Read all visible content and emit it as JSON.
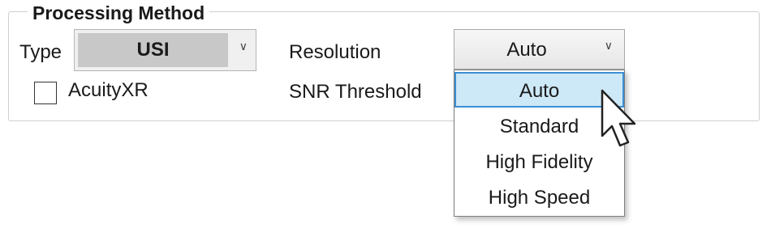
{
  "group": {
    "title": "Processing Method"
  },
  "type": {
    "label": "Type",
    "value": "USI",
    "arrow_icon": "chevron-down-icon"
  },
  "acuity": {
    "label": "AcuityXR",
    "checked": false
  },
  "resolution": {
    "label": "Resolution",
    "value": "Auto",
    "arrow_icon": "chevron-down-icon",
    "options": [
      "Auto",
      "Standard",
      "High Fidelity",
      "High Speed"
    ],
    "selected_index": 0
  },
  "snr": {
    "label": "SNR Threshold"
  },
  "colors": {
    "selection_bg": "#cde8f7",
    "selection_border": "#3b8fd3",
    "type_value_bg": "#c8c8c8"
  }
}
